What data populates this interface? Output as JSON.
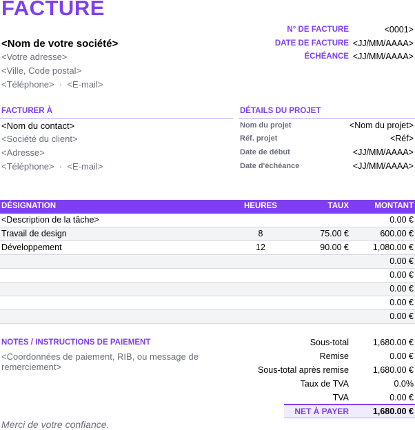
{
  "header": {
    "title": "FACTURE",
    "company": "<Nom de votre société>",
    "address": "<Votre adresse>",
    "city": "<Ville, Code postal>",
    "contact": "<Téléphone>  ·  <E-mail>"
  },
  "meta": {
    "invoice_no_label": "N° DE FACTURE",
    "invoice_no": "<0001>",
    "date_label": "DATE DE FACTURE",
    "date": "<JJ/MM/AAAA>",
    "due_label": "ÉCHÉANCE",
    "due": "<JJ/MM/AAAA>"
  },
  "bill_to": {
    "heading": "FACTURER À",
    "contact_name": "<Nom du contact>",
    "company": "<Société du client>",
    "address": "<Adresse>",
    "contact": "<Téléphone>  ·  <E-mail>"
  },
  "project": {
    "heading": "DÉTAILS DU PROJET",
    "items": [
      {
        "label": "Nom du projet",
        "value": "<Nom du projet>"
      },
      {
        "label": "Réf. projet",
        "value": "<Réf>"
      },
      {
        "label": "Date de début",
        "value": "<JJ/MM/AAAA>"
      },
      {
        "label": "Date d'échéance",
        "value": "<JJ/MM/AAAA>"
      }
    ]
  },
  "table": {
    "headers": {
      "description": "DÉSIGNATION",
      "hours": "HEURES",
      "rate": "TAUX",
      "amount": "MONTANT"
    },
    "rows": [
      {
        "description": "<Description de la tâche>",
        "hours": "",
        "rate": "",
        "amount": "0.00 €"
      },
      {
        "description": "Travail de design",
        "hours": "8",
        "rate": "75.00 €",
        "amount": "600.00 €"
      },
      {
        "description": "Développement",
        "hours": "12",
        "rate": "90.00 €",
        "amount": "1,080.00 €"
      },
      {
        "description": "",
        "hours": "",
        "rate": "",
        "amount": "0.00 €"
      },
      {
        "description": "",
        "hours": "",
        "rate": "",
        "amount": "0.00 €"
      },
      {
        "description": "",
        "hours": "",
        "rate": "",
        "amount": "0.00 €"
      },
      {
        "description": "",
        "hours": "",
        "rate": "",
        "amount": "0.00 €"
      },
      {
        "description": "",
        "hours": "",
        "rate": "",
        "amount": "0.00 €"
      }
    ]
  },
  "notes": {
    "heading": "NOTES / INSTRUCTIONS DE PAIEMENT",
    "text": "<Coordonnées de paiement, RIB, ou message de remerciement>"
  },
  "totals": [
    {
      "label": "Sous-total",
      "value": "1,680.00 €"
    },
    {
      "label": "Remise",
      "value": "0.00 €"
    },
    {
      "label": "Sous-total après remise",
      "value": "1,680.00 €"
    },
    {
      "label": "Taux de TVA",
      "value": "0.0%"
    },
    {
      "label": "TVA",
      "value": "0.00 €"
    }
  ],
  "net": {
    "label": "NET À PAYER",
    "value": "1,680.00 €"
  },
  "footer": "Merci de votre confiance.",
  "colors": {
    "accent": "#7e3ff2",
    "muted": "#6b6e7a"
  }
}
